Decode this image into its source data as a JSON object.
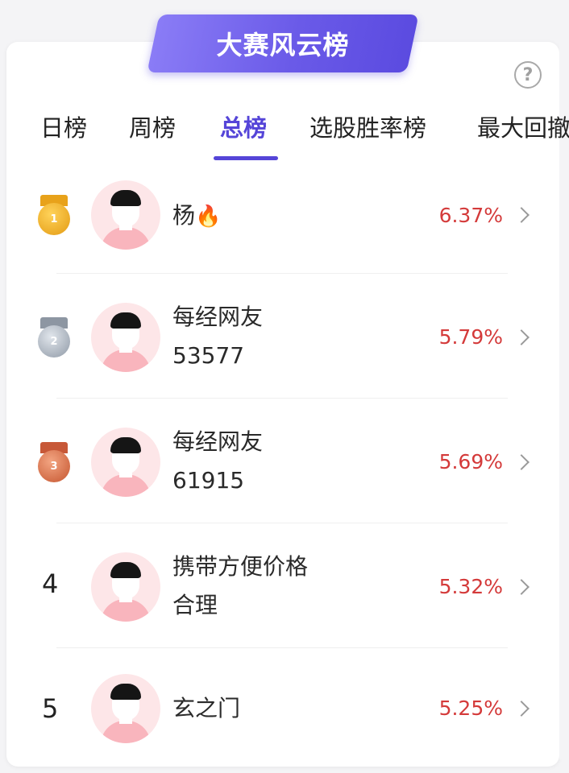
{
  "header": {
    "title": "大赛风云榜",
    "help_icon": "?"
  },
  "tabs": [
    {
      "label": "日榜",
      "active": false
    },
    {
      "label": "周榜",
      "active": false
    },
    {
      "label": "总榜",
      "active": true
    },
    {
      "label": "选股胜率榜",
      "active": false
    },
    {
      "label": "最大回撤",
      "active": false
    }
  ],
  "colors": {
    "accent": "#5545d8",
    "percent": "#d43a3a",
    "gold": "#e8a21a",
    "silver": "#9aa4b0",
    "bronze": "#c9613e"
  },
  "rankings": [
    {
      "rank": "1",
      "badge": "gold-medal-icon",
      "name_line1": "杨",
      "name_line2": "",
      "fire": "🔥",
      "percent": "6.37%"
    },
    {
      "rank": "2",
      "badge": "silver-medal-icon",
      "name_line1": "每经网友",
      "name_line2": "53577",
      "fire": "",
      "percent": "5.79%"
    },
    {
      "rank": "3",
      "badge": "bronze-medal-icon",
      "name_line1": "每经网友",
      "name_line2": "61915",
      "fire": "",
      "percent": "5.69%"
    },
    {
      "rank": "4",
      "badge": "",
      "name_line1": "携带方便价格",
      "name_line2": "合理",
      "fire": "",
      "percent": "5.32%"
    },
    {
      "rank": "5",
      "badge": "",
      "name_line1": "玄之门",
      "name_line2": "",
      "fire": "",
      "percent": "5.25%"
    }
  ]
}
